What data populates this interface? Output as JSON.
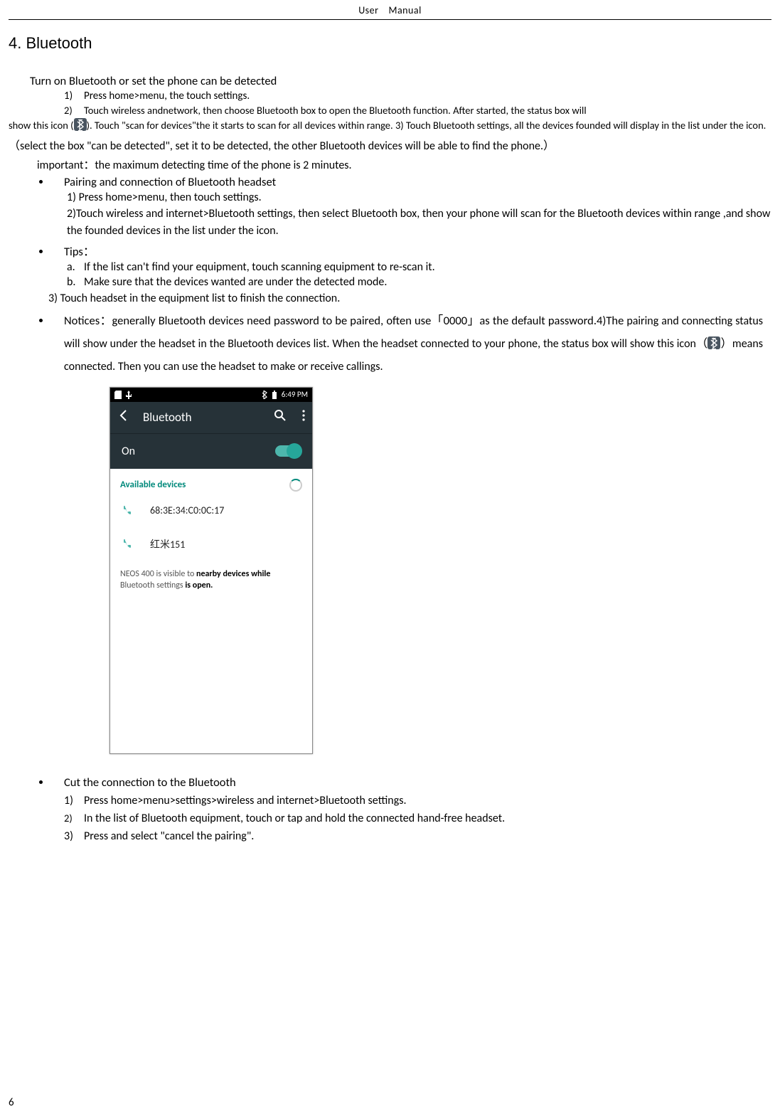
{
  "header": {
    "left": "User",
    "right": "Manual"
  },
  "section_title": "4. Bluetooth",
  "turn_on": {
    "heading": "Turn on Bluetooth or set the phone can be detected",
    "step1": "Press home>menu, the touch settings.",
    "step2": "Touch wireless andnetwork, then choose Bluetooth box to open the Bluetooth function. After started, the status box will",
    "para1_a": "show this icon (",
    "para1_b": "). Touch \"scan for devices\"the it starts to scan for all devices within range. 3) Touch Bluetooth settings, all the devices founded will display in the list under the icon.",
    "para2": "（select the box \"can be detected\", set it to be detected, the other Bluetooth devices will be able to find the phone.）",
    "important": "important：the maximum detecting time of the phone is 2 minutes."
  },
  "pairing": {
    "heading": "Pairing and connection of Bluetooth headset",
    "step1": "1) Press home>menu, then touch settings.",
    "step2": "2)Touch wireless and internet>Bluetooth settings, then select Bluetooth box, then your phone will scan for the Bluetooth devices within range ,and show the founded devices in the list under the icon."
  },
  "tips": {
    "heading": "Tips：",
    "a": "If the list can't find your equipment, touch scanning equipment to re-scan it.",
    "b": "Make sure that the devices wanted are under the detected mode.",
    "step3": "3) Touch headset in the equipment list to finish the connection."
  },
  "notices": {
    "head": "Notices：generally Bluetooth devices need password to be paired, often use「0000」as the default password.4)The",
    "body_a": "pairing and connecting status will show under the headset in the Bluetooth devices list. When the headset connected to your phone, the status box will show this icon（",
    "body_b": "）means connected. Then you can use the headset to make or receive callings."
  },
  "phone": {
    "time": "6:49 PM",
    "title": "Bluetooth",
    "on_label": "On",
    "available_label": "Available devices",
    "device1": "68:3E:34:C0:0C:17",
    "device2": "红米151",
    "visibility_a": "NEOS 400 is visible to ",
    "visibility_b": "nearby devices while",
    "visibility_c": "Bluetooth settings ",
    "visibility_d": "is open."
  },
  "cut": {
    "heading": "Cut the connection to the Bluetooth",
    "step1": "Press home>menu>settings>wireless and internet>Bluetooth settings.",
    "step2": "In the list of Bluetooth equipment, touch or tap and hold the connected hand-free headset.",
    "step3": "Press and select \"cancel the pairing\"."
  },
  "page_number": "6"
}
